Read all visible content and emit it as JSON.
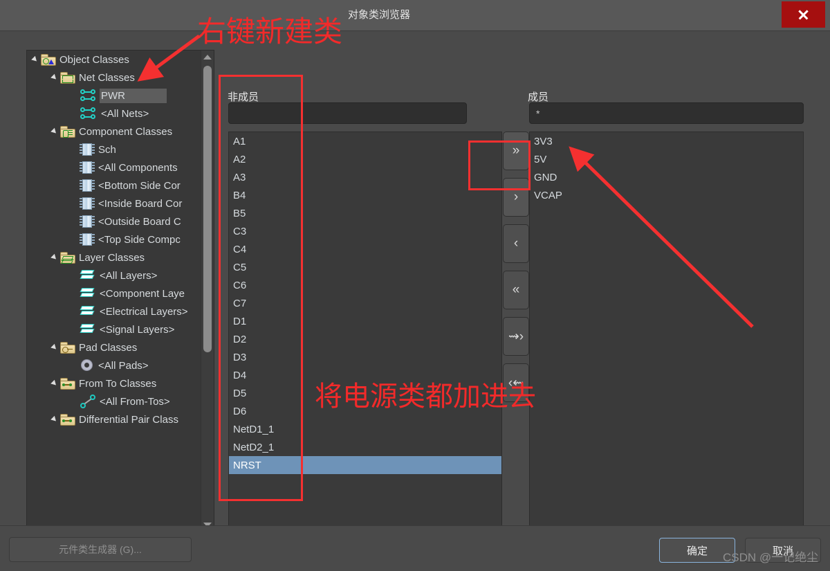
{
  "window": {
    "title": "对象类浏览器",
    "close_icon": "close-icon"
  },
  "tree": {
    "items": [
      {
        "label": "Object Classes",
        "depth": 0,
        "icon": "folder-object-classes-icon",
        "twisty": "open",
        "selected": false
      },
      {
        "label": "Net Classes",
        "depth": 1,
        "icon": "folder-net-classes-icon",
        "twisty": "open",
        "selected": false
      },
      {
        "label": "PWR",
        "depth": 2,
        "icon": "net-class-icon",
        "twisty": "none",
        "selected": true
      },
      {
        "label": "<All Nets>",
        "depth": 2,
        "icon": "net-class-icon",
        "twisty": "none",
        "selected": false
      },
      {
        "label": "Component Classes",
        "depth": 1,
        "icon": "folder-component-classes-icon",
        "twisty": "open",
        "selected": false
      },
      {
        "label": "Sch",
        "depth": 2,
        "icon": "component-chip-icon",
        "twisty": "none",
        "selected": false
      },
      {
        "label": "<All Components",
        "depth": 2,
        "icon": "component-chip-icon",
        "twisty": "none",
        "selected": false
      },
      {
        "label": "<Bottom Side Cor",
        "depth": 2,
        "icon": "component-chip-icon",
        "twisty": "none",
        "selected": false
      },
      {
        "label": "<Inside Board Cor",
        "depth": 2,
        "icon": "component-chip-icon",
        "twisty": "none",
        "selected": false
      },
      {
        "label": "<Outside Board C",
        "depth": 2,
        "icon": "component-chip-icon",
        "twisty": "none",
        "selected": false
      },
      {
        "label": "<Top Side Compc",
        "depth": 2,
        "icon": "component-chip-icon",
        "twisty": "none",
        "selected": false
      },
      {
        "label": "Layer Classes",
        "depth": 1,
        "icon": "folder-layer-classes-icon",
        "twisty": "open",
        "selected": false
      },
      {
        "label": "<All Layers>",
        "depth": 2,
        "icon": "layer-stack-icon",
        "twisty": "none",
        "selected": false
      },
      {
        "label": "<Component Laye",
        "depth": 2,
        "icon": "layer-stack-icon",
        "twisty": "none",
        "selected": false
      },
      {
        "label": "<Electrical Layers>",
        "depth": 2,
        "icon": "layer-stack-icon",
        "twisty": "none",
        "selected": false
      },
      {
        "label": "<Signal Layers>",
        "depth": 2,
        "icon": "layer-stack-icon",
        "twisty": "none",
        "selected": false
      },
      {
        "label": "Pad Classes",
        "depth": 1,
        "icon": "folder-pad-classes-icon",
        "twisty": "open",
        "selected": false
      },
      {
        "label": "<All Pads>",
        "depth": 2,
        "icon": "pad-ring-icon",
        "twisty": "none",
        "selected": false
      },
      {
        "label": "From To Classes",
        "depth": 1,
        "icon": "folder-from-to-classes-icon",
        "twisty": "open",
        "selected": false
      },
      {
        "label": "<All From-Tos>",
        "depth": 2,
        "icon": "from-to-icon",
        "twisty": "none",
        "selected": false
      },
      {
        "label": "Differential Pair Class",
        "depth": 1,
        "icon": "folder-diff-pair-icon",
        "twisty": "open",
        "selected": false
      }
    ]
  },
  "nonmembers": {
    "label": "非成员",
    "filter_value": "",
    "filter_placeholder": "",
    "items": [
      {
        "label": "A1",
        "selected": false
      },
      {
        "label": "A2",
        "selected": false
      },
      {
        "label": "A3",
        "selected": false
      },
      {
        "label": "B4",
        "selected": false
      },
      {
        "label": "B5",
        "selected": false
      },
      {
        "label": "C3",
        "selected": false
      },
      {
        "label": "C4",
        "selected": false
      },
      {
        "label": "C5",
        "selected": false
      },
      {
        "label": "C6",
        "selected": false
      },
      {
        "label": "C7",
        "selected": false
      },
      {
        "label": "D1",
        "selected": false
      },
      {
        "label": "D2",
        "selected": false
      },
      {
        "label": "D3",
        "selected": false
      },
      {
        "label": "D4",
        "selected": false
      },
      {
        "label": "D5",
        "selected": false
      },
      {
        "label": "D6",
        "selected": false
      },
      {
        "label": "NetD1_1",
        "selected": false
      },
      {
        "label": "NetD2_1",
        "selected": false
      },
      {
        "label": "NRST",
        "selected": true
      }
    ]
  },
  "members": {
    "label": "成员",
    "filter_value": "*",
    "filter_placeholder": "",
    "items": [
      {
        "label": "3V3",
        "selected": false
      },
      {
        "label": "5V",
        "selected": false
      },
      {
        "label": "GND",
        "selected": false
      },
      {
        "label": "VCAP",
        "selected": false
      }
    ]
  },
  "transfer_buttons": [
    {
      "glyph": "»",
      "name": "add-all-button",
      "icon": "double-chevron-right-icon"
    },
    {
      "glyph": "›",
      "name": "add-button",
      "icon": "chevron-right-icon"
    },
    {
      "glyph": "‹",
      "name": "remove-button",
      "icon": "chevron-left-icon"
    },
    {
      "glyph": "«",
      "name": "remove-all-button",
      "icon": "double-chevron-left-icon"
    },
    {
      "glyph": "⇝›",
      "name": "move-all-right-button",
      "icon": "arrow-bars-right-icon"
    },
    {
      "glyph": "‹⇜",
      "name": "move-all-left-button",
      "icon": "arrow-bars-left-icon"
    }
  ],
  "footer": {
    "generator_label": "元件类生成器 (G)...",
    "ok_label": "确定",
    "cancel_label": "取消",
    "watermark": "CSDN @一记绝尘"
  },
  "annotations": {
    "note_new_class": "右键新建类",
    "note_add_power": "将电源类都加进去",
    "accent_color": "#f43030"
  },
  "colors": {
    "dialog_bg": "#4a4a4a",
    "titlebar_bg": "#585858",
    "list_bg": "#3a3a3a",
    "close_red": "#a50f0f",
    "selection_blue": "#6e93b8",
    "tree_selection": "#5d5d5d",
    "focus_border": "#8ab4dd",
    "annotation_red": "#f43030"
  }
}
